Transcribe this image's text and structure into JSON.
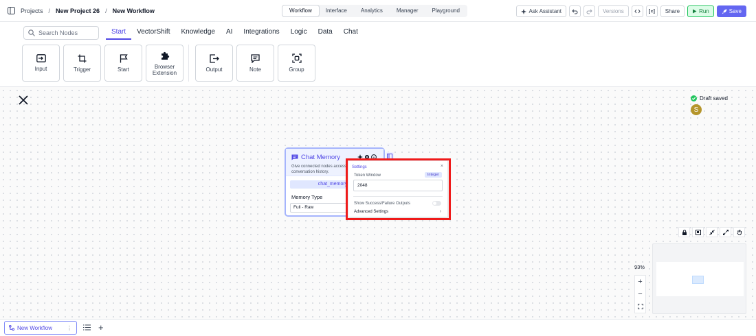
{
  "topbar": {
    "breadcrumbs": [
      "Projects",
      "New Project 26",
      "New Workflow"
    ],
    "tabs": [
      "Workflow",
      "Interface",
      "Analytics",
      "Manager",
      "Playground"
    ],
    "active_tab": "Workflow",
    "ask_assistant": "Ask Assistant",
    "versions": "Versions",
    "share": "Share",
    "run": "Run",
    "save": "Save"
  },
  "nodebar": {
    "search_placeholder": "Search Nodes",
    "categories": [
      "Start",
      "VectorShift",
      "Knowledge",
      "AI",
      "Integrations",
      "Logic",
      "Data",
      "Chat"
    ],
    "active_category": "Start",
    "tiles": [
      {
        "label": "Input",
        "icon": "input-icon"
      },
      {
        "label": "Trigger",
        "icon": "crop-icon"
      },
      {
        "label": "Start",
        "icon": "flag-icon"
      },
      {
        "label": "Browser Extension",
        "icon": "puzzle-icon"
      },
      {
        "label": "Output",
        "icon": "output-icon"
      },
      {
        "label": "Note",
        "icon": "note-icon"
      },
      {
        "label": "Group",
        "icon": "group-icon"
      }
    ]
  },
  "canvas": {
    "draft_status": "Draft saved",
    "avatar_initial": "S",
    "zoom_level": "93%"
  },
  "node": {
    "title": "Chat Memory",
    "description": "Give connected nodes access to conversation history.",
    "output_pill": "chat_memory",
    "memory_type_label": "Memory Type",
    "memory_type_value": "Full - Raw"
  },
  "settings": {
    "title": "Settings",
    "token_window_label": "Token Window",
    "token_window_type": "Integer",
    "token_window_value": "2048",
    "show_outputs_label": "Show Success/Failure Outputs",
    "advanced_label": "Advanced Settings"
  },
  "bottombar": {
    "workflow_tab": "New Workflow"
  },
  "colors": {
    "accent": "#4f46e5",
    "run": "#22c55e",
    "save": "#6366f1",
    "highlight": "#ef1a1a"
  }
}
